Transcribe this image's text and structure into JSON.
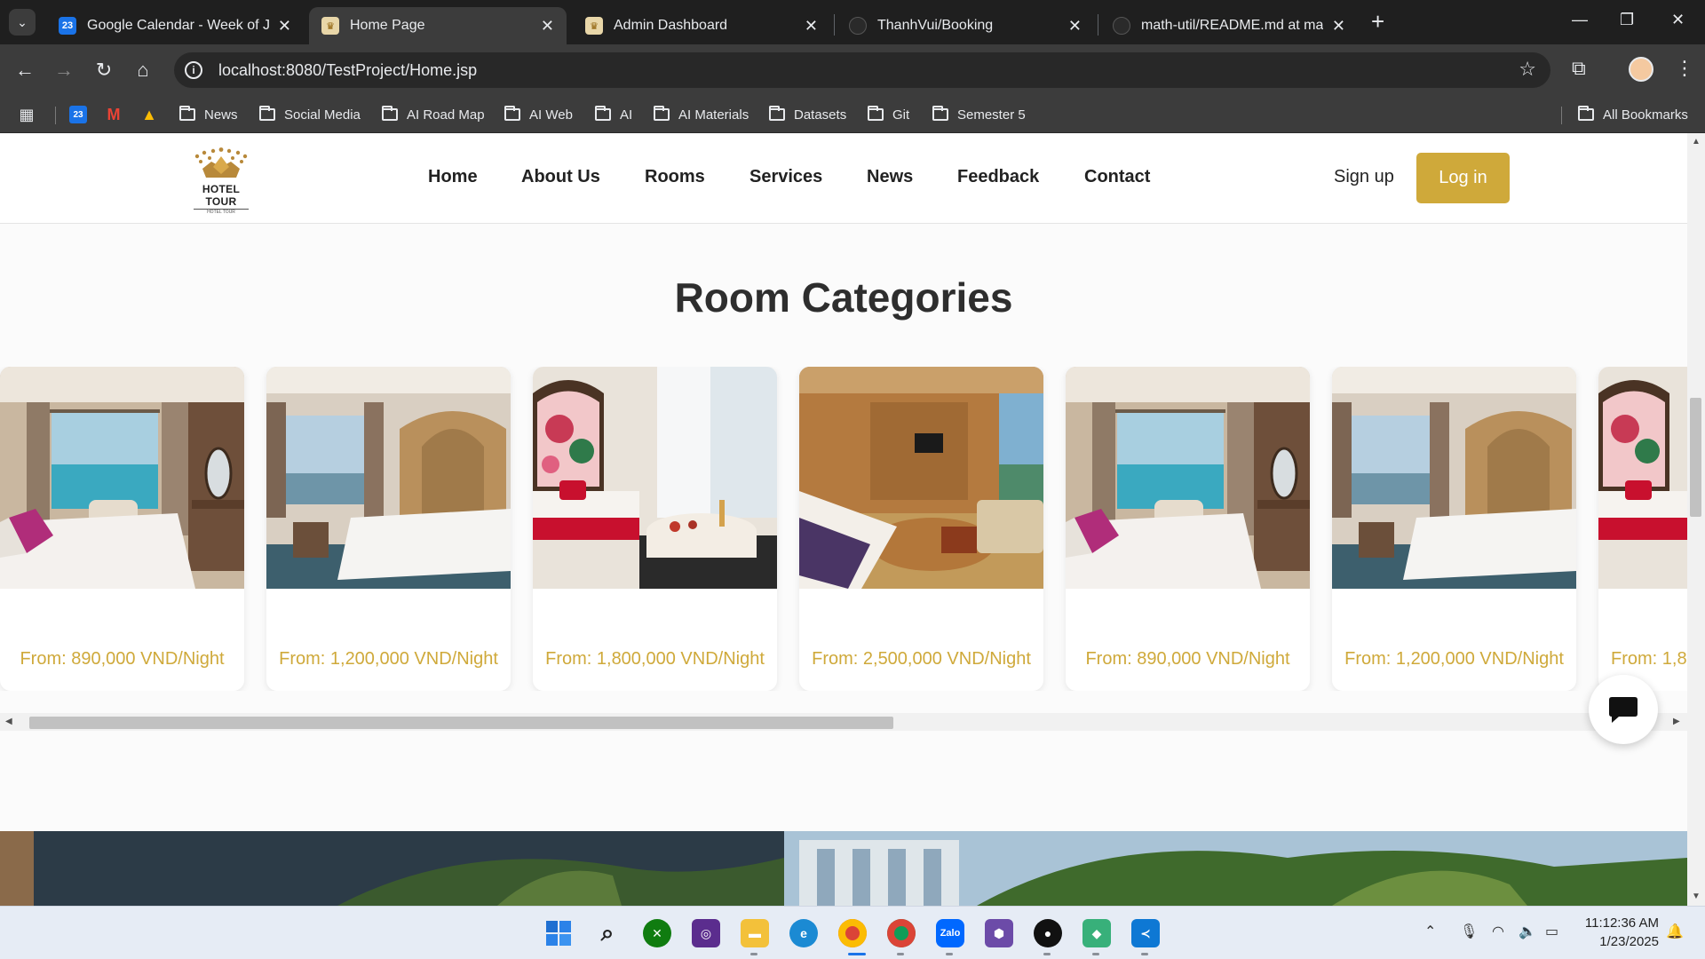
{
  "browser": {
    "tabs": [
      {
        "title": "Google Calendar - Week of Janu",
        "active": false
      },
      {
        "title": "Home Page",
        "active": true
      },
      {
        "title": "Admin Dashboard",
        "active": false
      },
      {
        "title": "ThanhVui/Booking",
        "active": false
      },
      {
        "title": "math-util/README.md at main",
        "active": false
      }
    ],
    "url": "localhost:8080/TestProject/Home.jsp",
    "bookmarks": [
      "News",
      "Social Media",
      "AI Road Map",
      "AI Web",
      "AI",
      "AI Materials",
      "Datasets",
      "Git",
      "Semester 5"
    ],
    "all_bookmarks_label": "All Bookmarks"
  },
  "site": {
    "logo": {
      "brand": "HOTEL TOUR",
      "tagline": "HOTEL TOUR"
    },
    "nav": [
      "Home",
      "About Us",
      "Rooms",
      "Services",
      "News",
      "Feedback",
      "Contact"
    ],
    "signup_label": "Sign up",
    "login_label": "Log in",
    "section_title": "Room Categories",
    "rooms": [
      {
        "price": "From: 890,000 VND/Night",
        "photo": "room-sea-view-pink-pillow"
      },
      {
        "price": "From: 1,200,000 VND/Night",
        "photo": "room-balcony-ornate-headboard"
      },
      {
        "price": "From: 1,800,000 VND/Night",
        "photo": "room-bathtub-flamingo-art"
      },
      {
        "price": "From: 2,500,000 VND/Night",
        "photo": "suite-wood-panel-living"
      },
      {
        "price": "From: 890,000 VND/Night",
        "photo": "room-sea-view-pink-pillow"
      },
      {
        "price": "From: 1,200,000 VND/Night",
        "photo": "room-balcony-ornate-headboard"
      },
      {
        "price": "From: 1,8",
        "photo": "room-bathtub-flamingo-art"
      }
    ],
    "chat_icon": "chat-bubble-icon"
  },
  "taskbar": {
    "time": "11:12:36 AM",
    "date": "1/23/2025"
  },
  "colors": {
    "accent_gold": "#cfa93a",
    "browser_dark": "#3c3c3c"
  }
}
